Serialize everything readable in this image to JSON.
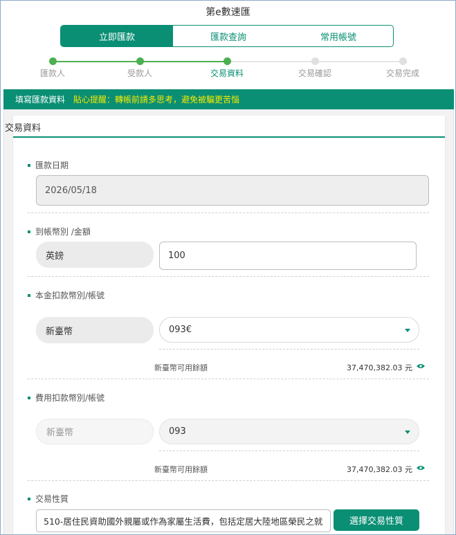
{
  "app": {
    "title": "第e數速匯"
  },
  "tabs": [
    {
      "label": "立即匯款",
      "active": true
    },
    {
      "label": "匯款查詢",
      "active": false
    },
    {
      "label": "常用帳號",
      "active": false
    }
  ],
  "steps": [
    {
      "label": "匯款人",
      "state": "done"
    },
    {
      "label": "受款人",
      "state": "done"
    },
    {
      "label": "交易資料",
      "state": "current"
    },
    {
      "label": "交易確認",
      "state": "todo"
    },
    {
      "label": "交易完成",
      "state": "todo"
    }
  ],
  "banner": {
    "title": "填寫匯款資料",
    "tip": "貼心提醒：轉帳前請多思考，避免被騙更苦惱"
  },
  "section": {
    "title": "交易資料"
  },
  "remit_date": {
    "label": "匯款日期",
    "value": "2026/05/18"
  },
  "currency_amount": {
    "label": "到帳幣別 /金額",
    "currency": "英鎊",
    "amount": "100"
  },
  "principal_debit": {
    "label": "本金扣款幣別/帳號",
    "currency": "新臺幣",
    "account": "093€",
    "balance_label": "新臺幣可用餘額",
    "balance_value": "37,470,382.03 元"
  },
  "fee_debit": {
    "label": "費用扣款幣別/帳號",
    "currency": "新臺幣",
    "account": "093",
    "balance_label": "新臺幣可用餘額",
    "balance_value": "37,470,382.03 元"
  },
  "transaction_nature": {
    "label": "交易性質",
    "value": "510-居住民資助國外親屬或作為家屬生活費，包括定居大陸地區榮民之就",
    "button": "選擇交易性質"
  },
  "colors": {
    "brand_green": "#0a8f74",
    "step_green": "#4caf50",
    "tip_yellow": "#f5e900"
  }
}
